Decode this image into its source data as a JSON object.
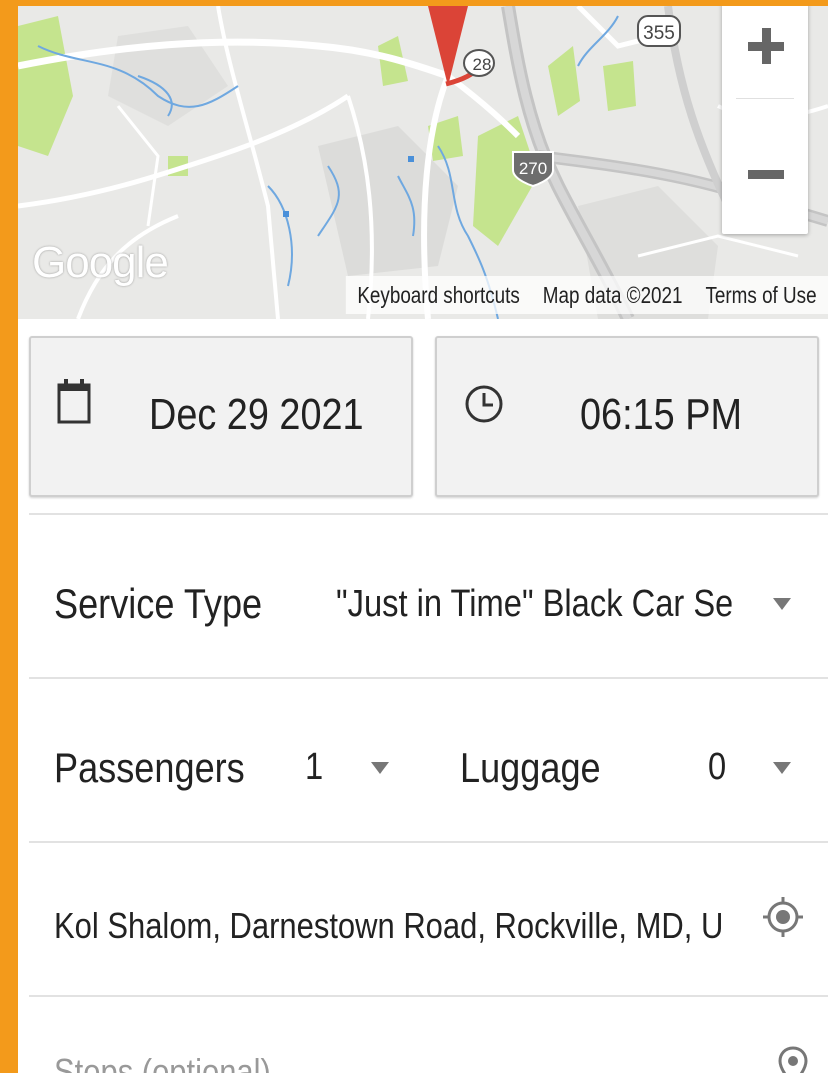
{
  "map": {
    "route_shields": [
      "355",
      "270",
      "28"
    ],
    "google_logo": "Google",
    "attribution": [
      "Keyboard shortcuts",
      "Map data ©2021",
      "Terms of Use"
    ],
    "zoom_in_icon": "plus-icon",
    "zoom_out_icon": "minus-icon"
  },
  "booking": {
    "date": "Dec 29 2021",
    "time": "06:15 PM",
    "service_type_label": "Service Type",
    "service_type_value": "\"Just in Time\" Black Car Ser",
    "passengers_label": "Passengers",
    "passengers_value": "1",
    "luggage_label": "Luggage",
    "luggage_value": "0",
    "pickup_value": "Kol Shalom, Darnestown Road, Rockville, MD, U",
    "stops_placeholder": "Stops (optional)"
  },
  "colors": {
    "border_frame": "#f39a1b",
    "map_marker": "#db4437",
    "park_green": "#c5e48e",
    "water": "#4a90d9"
  }
}
